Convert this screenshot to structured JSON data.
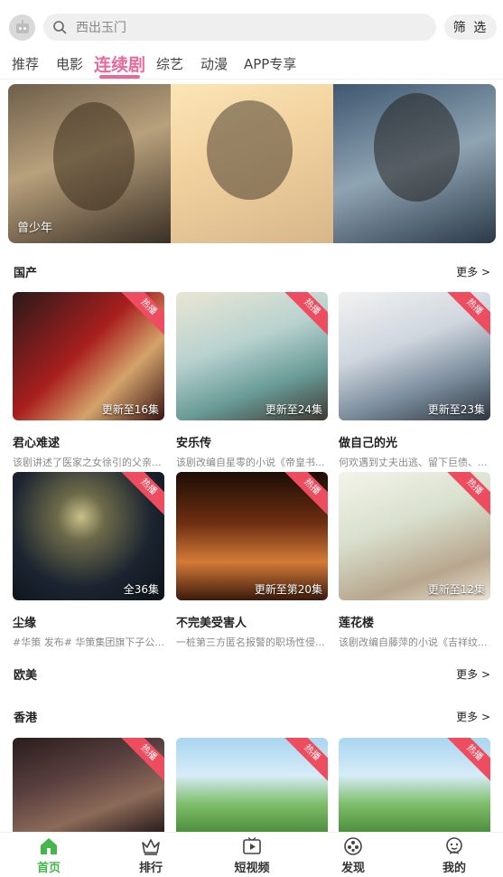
{
  "search": {
    "placeholder": "西出玉门"
  },
  "filter_button": "筛 选",
  "tabs": [
    {
      "label": "推荐",
      "active": false
    },
    {
      "label": "电影",
      "active": false
    },
    {
      "label": "连续剧",
      "active": true
    },
    {
      "label": "综艺",
      "active": false
    },
    {
      "label": "动漫",
      "active": false
    },
    {
      "label": "APP专享",
      "active": false
    }
  ],
  "banner": {
    "caption": "曾少年"
  },
  "sections": {
    "domestic": {
      "title": "国产",
      "more": "更多 >",
      "items": [
        {
          "title": "君心难逑",
          "desc": "该剧讲述了医家之女徐引的父亲...",
          "episode": "更新至16集",
          "badge": "热播"
        },
        {
          "title": "安乐传",
          "desc": "该剧改编自星零的小说《帝皇书...",
          "episode": "更新至24集",
          "badge": "热播"
        },
        {
          "title": "做自己的光",
          "desc": "何欢遇到丈夫出逃、留下巨债、...",
          "episode": "更新至23集",
          "badge": "热播"
        },
        {
          "title": "尘缘",
          "desc": "#华策 发布# 华策集团旗下子公...",
          "episode": "全36集",
          "badge": "热播"
        },
        {
          "title": "不完美受害人",
          "desc": "一桩第三方匿名报警的职场性侵...",
          "episode": "更新至第20集",
          "badge": "热播"
        },
        {
          "title": "莲花楼",
          "desc": "该剧改编自藤萍的小说《吉祥纹...",
          "episode": "更新至12集",
          "badge": "热播"
        }
      ]
    },
    "western": {
      "title": "欧美",
      "more": "更多 >"
    },
    "hongkong": {
      "title": "香港",
      "more": "更多 >",
      "items": [
        {
          "badge": "热播"
        },
        {
          "badge": "热播"
        },
        {
          "badge": "热播"
        }
      ]
    }
  },
  "bottom_nav": [
    {
      "label": "首页",
      "icon": "home-icon",
      "active": true
    },
    {
      "label": "排行",
      "icon": "crown-icon",
      "active": false
    },
    {
      "label": "短视频",
      "icon": "play-icon",
      "active": false
    },
    {
      "label": "发现",
      "icon": "discover-icon",
      "active": false
    },
    {
      "label": "我的",
      "icon": "profile-icon",
      "active": false
    }
  ],
  "colors": {
    "accent": "#e86a9a",
    "nav_active": "#45b649",
    "hot_badge": "#ee4d5f"
  }
}
